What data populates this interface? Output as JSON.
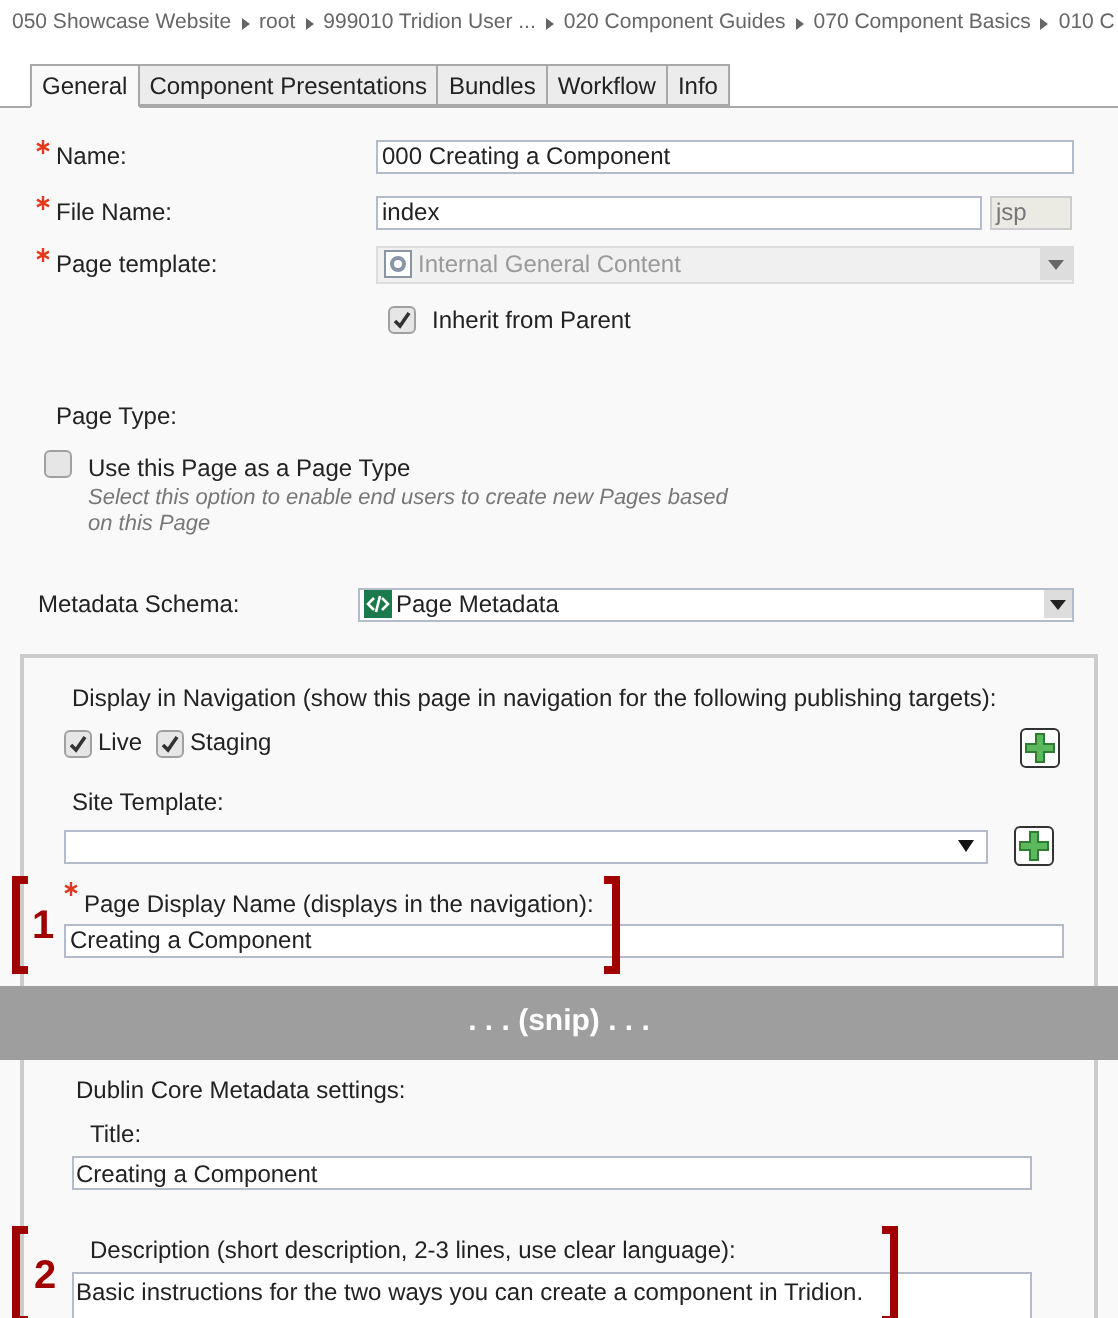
{
  "breadcrumb": [
    "050 Showcase Website",
    "root",
    "999010 Tridion User ...",
    "020 Component Guides",
    "070 Component Basics",
    "010 C"
  ],
  "tabs": [
    {
      "label": "General",
      "selected": true
    },
    {
      "label": "Component Presentations",
      "selected": false
    },
    {
      "label": "Bundles",
      "selected": false
    },
    {
      "label": "Workflow",
      "selected": false
    },
    {
      "label": "Info",
      "selected": false
    }
  ],
  "general": {
    "name": {
      "label": "Name:",
      "required": true,
      "value": "000 Creating a Component"
    },
    "file_name": {
      "label": "File Name:",
      "required": true,
      "value": "index",
      "extension": "jsp"
    },
    "page_template": {
      "label": "Page template:",
      "required": true,
      "value": "Internal General Content",
      "disabled": true
    },
    "inherit": {
      "label": "Inherit from Parent",
      "checked": true
    },
    "page_type": {
      "heading": "Page Type:",
      "label": "Use this Page as a Page Type",
      "checked": false,
      "hint": "Select this option to enable end users to create new Pages based on this Page"
    },
    "metadata_schema": {
      "label": "Metadata Schema:",
      "value": "Page Metadata"
    }
  },
  "metadata": {
    "navigation": {
      "label": "Display in Navigation (show this page in navigation for the following publishing targets):",
      "targets": [
        {
          "label": "Live",
          "checked": true
        },
        {
          "label": "Staging",
          "checked": true
        }
      ]
    },
    "site_template": {
      "label": "Site Template:"
    },
    "display_name": {
      "label": "Page Display Name (displays in the navigation):",
      "required": true,
      "value": "Creating a Component",
      "annotation": "1"
    },
    "snip": ". . . (snip) . . .",
    "dublin_core": {
      "heading": "Dublin Core Metadata settings:",
      "title_label": "Title:",
      "title_value": "Creating a Component",
      "description_label": "Description (short description, 2-3 lines, use clear language):",
      "description_value": "Basic instructions for the two ways you can create a component in Tridion.",
      "annotation": "2"
    }
  }
}
